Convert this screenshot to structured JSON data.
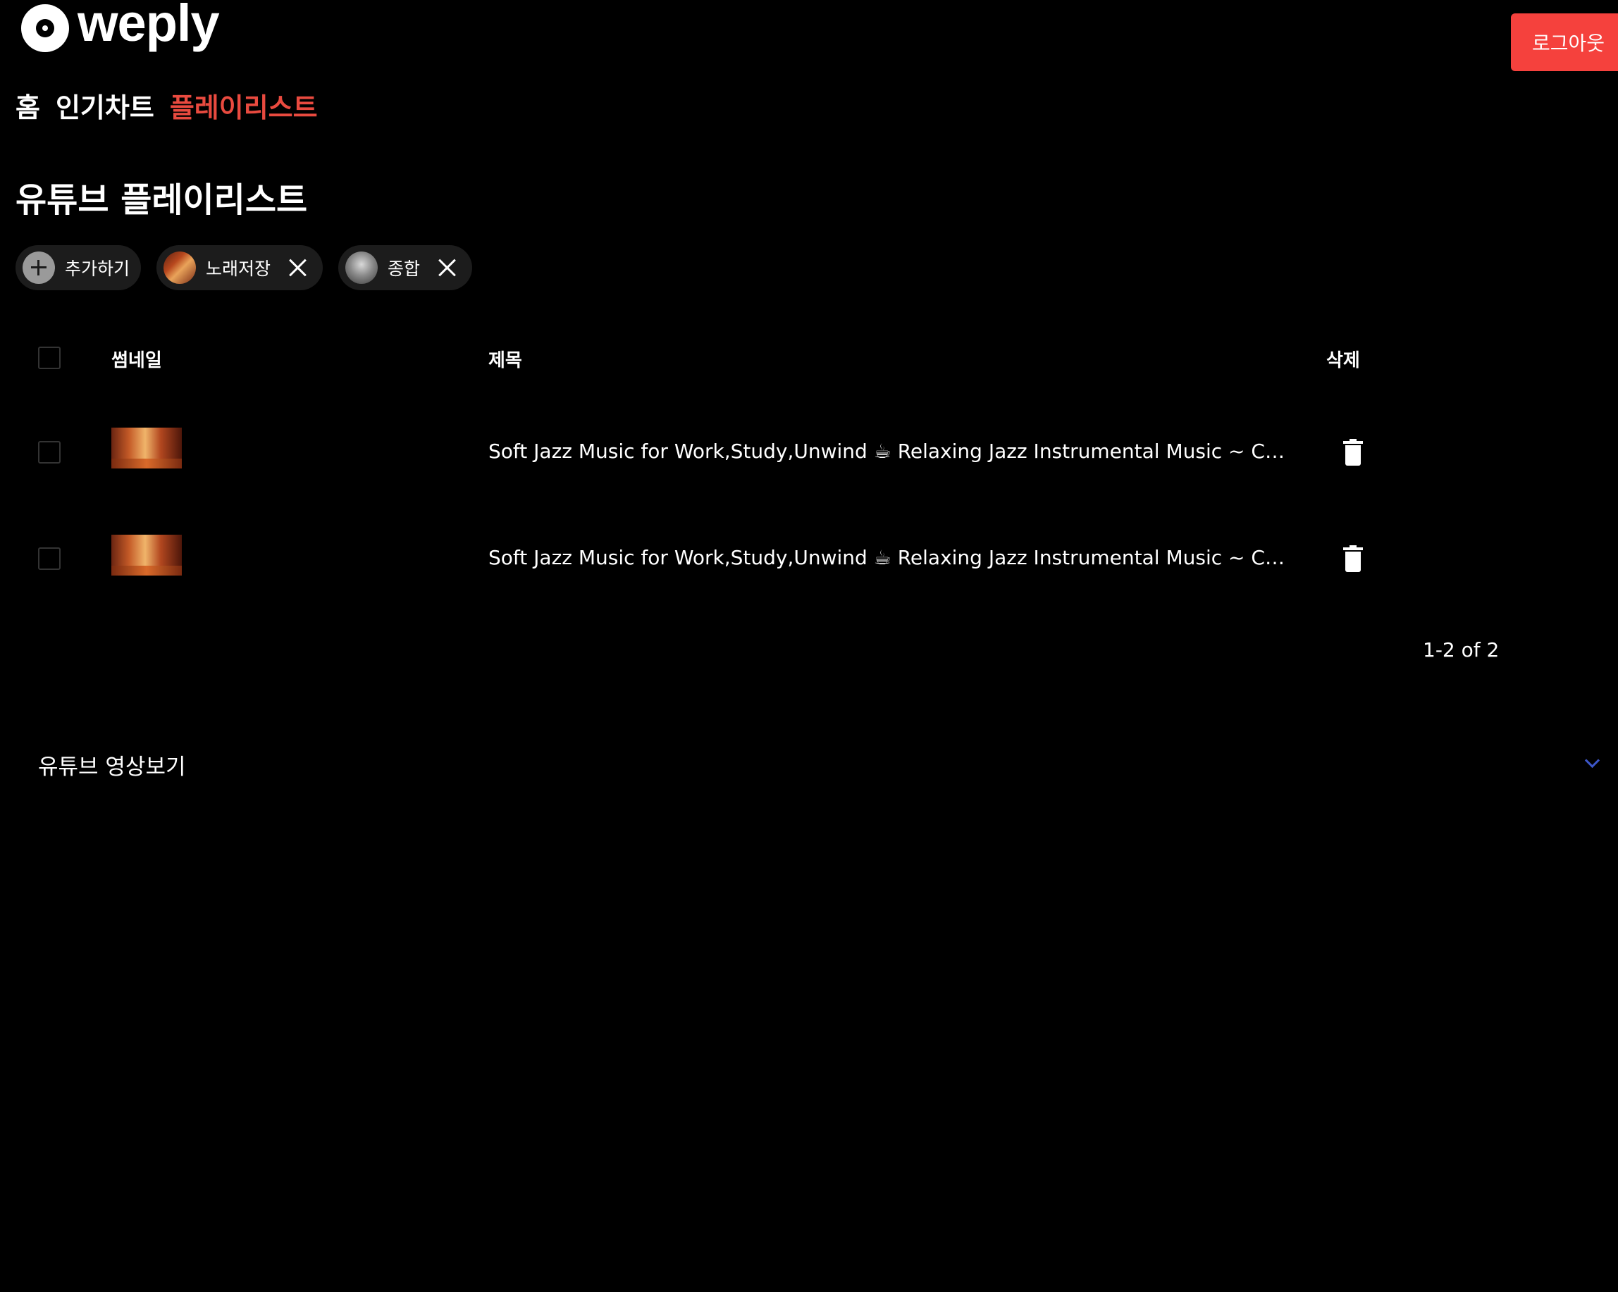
{
  "header": {
    "logo_text": "weply",
    "logout_label": "로그아웃"
  },
  "nav": {
    "items": [
      {
        "label": "홈",
        "active": false
      },
      {
        "label": "인기차트",
        "active": false
      },
      {
        "label": "플레이리스트",
        "active": true
      }
    ]
  },
  "page": {
    "title": "유튜브 플레이리스트"
  },
  "chips": {
    "add_label": "추가하기",
    "playlists": [
      {
        "label": "노래저장",
        "thumbnail": "cozy-jazz-cafe"
      },
      {
        "label": "종합",
        "thumbnail": "gray-album-art"
      }
    ]
  },
  "table": {
    "headers": {
      "thumbnail": "썸네일",
      "title": "제목",
      "delete": "삭제"
    },
    "rows": [
      {
        "thumbnail": "cozy-jazz-cafe",
        "title": "Soft Jazz Music for Work,Study,Unwind ☕ Relaxing Jazz Instrumental Music ~ Cozy Co..."
      },
      {
        "thumbnail": "cozy-jazz-cafe",
        "title": "Soft Jazz Music for Work,Study,Unwind ☕ Relaxing Jazz Instrumental Music ~ Cozy Co..."
      }
    ],
    "pagination": "1-2 of 2"
  },
  "video_section": {
    "label": "유튜브 영상보기"
  },
  "colors": {
    "background": "#000000",
    "accent": "#e94a3f",
    "logout_bg": "#f5413d",
    "chip_bg": "#1c1c1c",
    "chevron": "#3c56c8"
  },
  "icons": {
    "add": "plus-icon",
    "remove_chip": "close-icon",
    "delete_row": "trash-icon",
    "expand": "chevron-down-icon"
  }
}
